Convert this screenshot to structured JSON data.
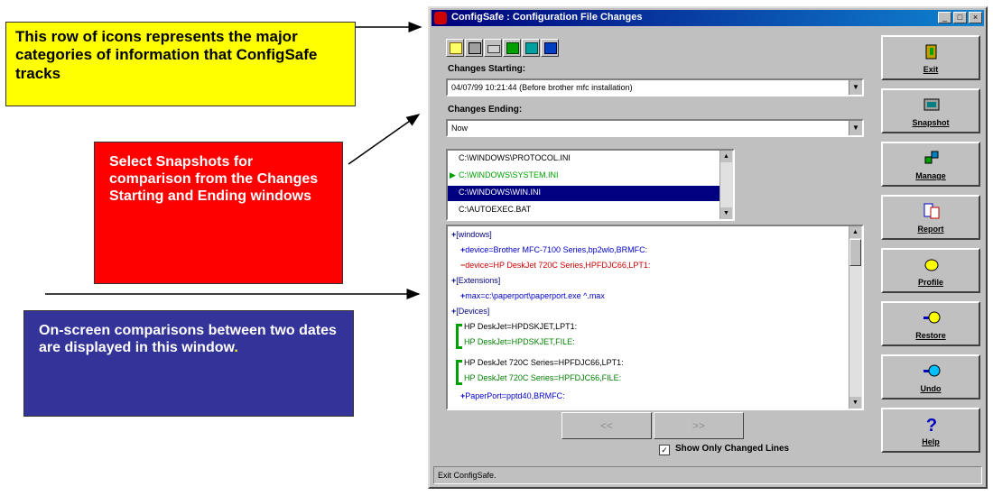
{
  "callouts": {
    "icons_row": "This row of icons represents the major categories of information that ConfigSafe tracks",
    "snapshots": "Select Snapshots for comparison from the Changes Starting and Ending windows",
    "comparisons": "On-screen comparisons between two dates are displayed in this window",
    "comparisons_end": "."
  },
  "window": {
    "title": "ConfigSafe : Configuration File Changes",
    "min": "_",
    "max": "□",
    "close": "×"
  },
  "toolbar": {
    "icons": [
      "folder-icon",
      "computer-icon",
      "card-icon",
      "network-icon",
      "software-icon",
      "lock-icon"
    ]
  },
  "changes_starting": {
    "label": "Changes Starting:",
    "value": "04/07/99 10:21:44 (Before brother mfc installation)"
  },
  "changes_ending": {
    "label": "Changes Ending:",
    "value": "Now"
  },
  "files": [
    "C:\\WINDOWS\\PROTOCOL.INI",
    "C:\\WINDOWS\\SYSTEM.INI",
    "C:\\WINDOWS\\WIN.INI",
    "C:\\AUTOEXEC.BAT"
  ],
  "selected_file_index": 2,
  "diff_lines": [
    {
      "prefix": "+",
      "text": "[windows]",
      "kind": "section"
    },
    {
      "prefix": "+",
      "text": "device=Brother MFC-7100 Series,bp2wlo,BRMFC:",
      "kind": "added"
    },
    {
      "prefix": "−",
      "text": "device=HP DeskJet 720C Series,HPFDJC66,LPT1:",
      "kind": "removed"
    },
    {
      "prefix": "+",
      "text": "[Extensions]",
      "kind": "section"
    },
    {
      "prefix": "+",
      "text": "max=c:\\paperport\\paperport.exe ^.max",
      "kind": "added"
    },
    {
      "prefix": "+",
      "text": "[Devices]",
      "kind": "section"
    },
    {
      "prefix": "",
      "text": "HP DeskJet=HPDSKJET,LPT1:",
      "kind": "changed-old"
    },
    {
      "prefix": "",
      "text": "HP DeskJet=HPDSKJET,FILE:",
      "kind": "changed-new"
    },
    {
      "prefix": "",
      "text": "HP DeskJet 720C Series=HPFDJC66,LPT1:",
      "kind": "changed-old"
    },
    {
      "prefix": "",
      "text": "HP DeskJet 720C Series=HPFDJC66,FILE:",
      "kind": "changed-new"
    },
    {
      "prefix": "+",
      "text": "PaperPort=pptd40,BRMFC:",
      "kind": "added"
    }
  ],
  "nav": {
    "prev": "<<",
    "next": ">>"
  },
  "show_only_changed": {
    "label": "Show Only Changed Lines",
    "checked": "✓"
  },
  "status": "Exit ConfigSafe.",
  "side_buttons": [
    {
      "label": "Exit",
      "icon": "exit-icon"
    },
    {
      "label": "Snapshot",
      "icon": "snapshot-icon"
    },
    {
      "label": "Manage",
      "icon": "manage-icon"
    },
    {
      "label": "Report",
      "icon": "report-icon"
    },
    {
      "label": "Profile",
      "icon": "profile-icon"
    },
    {
      "label": "Restore",
      "icon": "restore-icon"
    },
    {
      "label": "Undo",
      "icon": "undo-icon"
    },
    {
      "label": "Help",
      "icon": "help-icon"
    }
  ],
  "colors": {
    "selection": "#000080",
    "added": "#0000cc",
    "removed": "#cc0000",
    "changed": "#008000",
    "section": "#000080"
  }
}
